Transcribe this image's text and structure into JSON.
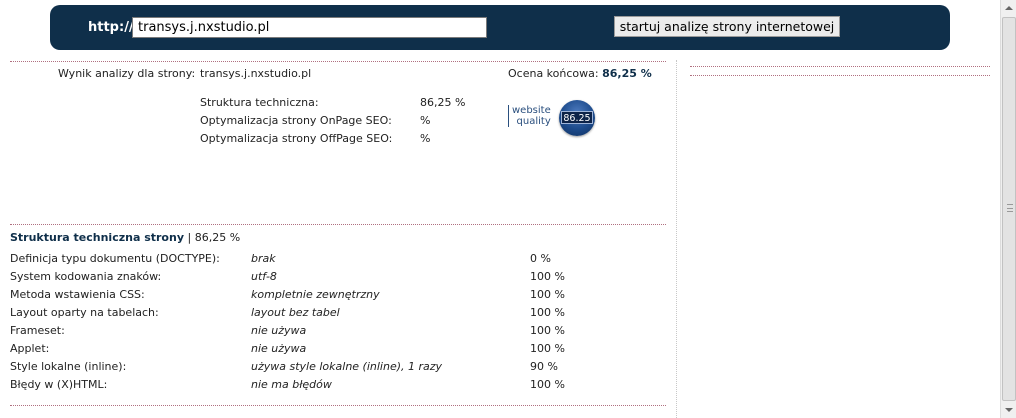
{
  "topbar": {
    "protocol": "http://",
    "url_value": "transys.j.nxstudio.pl",
    "submit_label": "startuj analizę strony internetowej"
  },
  "summary": {
    "label": "Wynik analizy dla strony:",
    "site": "transys.j.nxstudio.pl",
    "final_label": "Ocena końcowa:",
    "final_value": "86,25 %",
    "metrics": [
      {
        "label": "Struktura techniczna:",
        "value": "86,25 %"
      },
      {
        "label": "Optymalizacja strony OnPage SEO:",
        "value": "%"
      },
      {
        "label": "Optymalizacja strony OffPage SEO:",
        "value": "%"
      }
    ],
    "badge": {
      "text_line1": "website",
      "text_line2": "quality",
      "score": "86.25"
    }
  },
  "section": {
    "title": "Struktura techniczna strony",
    "separator": " | ",
    "score": "86,25 %",
    "rows": [
      {
        "label": "Definicja typu dokumentu (DOCTYPE):",
        "value": "brak",
        "score": "0 %"
      },
      {
        "label": "System kodowania znaków:",
        "value": "utf-8",
        "score": "100 %"
      },
      {
        "label": "Metoda wstawienia CSS:",
        "value": "kompletnie zewnętrzny",
        "score": "100 %"
      },
      {
        "label": "Layout oparty na tabelach:",
        "value": "layout bez tabel",
        "score": "100 %"
      },
      {
        "label": "Frameset:",
        "value": "nie używa",
        "score": "100 %"
      },
      {
        "label": "Applet:",
        "value": "nie używa",
        "score": "100 %"
      },
      {
        "label": "Style lokalne (inline):",
        "value": "używa style lokalne (inline), 1 razy",
        "score": "90 %"
      },
      {
        "label": "Błędy w (X)HTML:",
        "value": "nie ma błędów",
        "score": "100 %"
      }
    ]
  },
  "colors": {
    "header_bg": "#0f2f4a",
    "accent_text": "#0f2f4a",
    "rule": "#b07080"
  }
}
